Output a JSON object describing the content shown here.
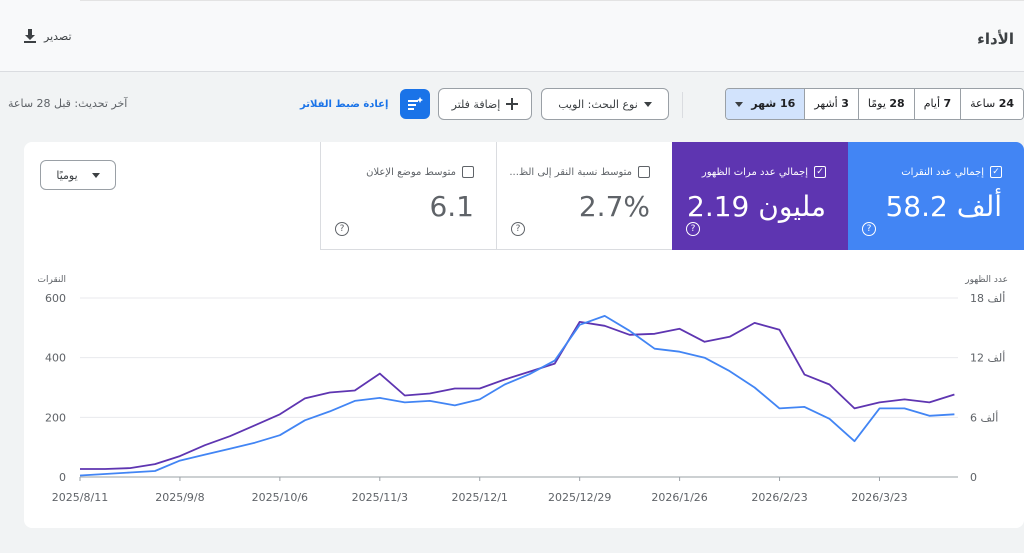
{
  "header": {
    "title": "الأداء",
    "export_label": "تصدير"
  },
  "filters": {
    "last_updated": "آخر تحديث: قبل 28 ساعة",
    "reset_label": "إعادة ضبط الفلاتر",
    "add_filter_label": "إضافة فلتر",
    "search_type_label": "نوع البحث: الويب",
    "date_ranges": [
      {
        "num": "24",
        "unit": "ساعة"
      },
      {
        "num": "7",
        "unit": "أيام"
      },
      {
        "num": "28",
        "unit": "يومًا"
      },
      {
        "num": "3",
        "unit": "أشهر"
      },
      {
        "num": "16",
        "unit": "شهر"
      }
    ],
    "selected_range_index": 4
  },
  "metrics": {
    "clicks": {
      "label": "إجمالي عدد النقرات",
      "value": "58.2 ألف",
      "checked": true,
      "color": "#4285f4"
    },
    "impressions": {
      "label": "إجمالي عدد مرات الظهور",
      "value": "2.19 مليون",
      "checked": true,
      "color": "#5e35b1"
    },
    "ctr": {
      "label": "متوسط نسبة النقر إلى الظ...",
      "value": "2.7%",
      "checked": false
    },
    "position": {
      "label": "متوسط موضع الإعلان",
      "value": "6.1",
      "checked": false
    }
  },
  "granularity": {
    "label": "يوميًا"
  },
  "chart_data": {
    "type": "line",
    "left_axis_title": "النقرات",
    "right_axis_title": "عدد الظهور",
    "left_ticks": [
      "0",
      "200",
      "400",
      "600"
    ],
    "right_ticks": [
      "0",
      "6 ألف",
      "12 ألف",
      "18 ألف"
    ],
    "left_ylim": [
      0,
      600
    ],
    "right_ylim": [
      0,
      18000
    ],
    "x_labels": [
      "2025/8/11",
      "2025/9/8",
      "2025/10/6",
      "2025/11/3",
      "2025/12/1",
      "2025/12/29",
      "2026/1/26",
      "2026/2/23",
      "2026/3/23"
    ],
    "grid": true,
    "series": [
      {
        "name": "إجمالي عدد النقرات",
        "axis": "left",
        "color": "#4285f4",
        "x": [
          "2025/8/11",
          "2025/8/18",
          "2025/8/25",
          "2025/9/1",
          "2025/9/8",
          "2025/9/15",
          "2025/9/22",
          "2025/9/29",
          "2025/10/6",
          "2025/10/13",
          "2025/10/20",
          "2025/10/27",
          "2025/11/3",
          "2025/11/10",
          "2025/11/17",
          "2025/11/24",
          "2025/12/1",
          "2025/12/8",
          "2025/12/15",
          "2025/12/22",
          "2025/12/29",
          "2026/1/5",
          "2026/1/12",
          "2026/1/19",
          "2026/1/26",
          "2026/2/2",
          "2026/2/9",
          "2026/2/16",
          "2026/2/23",
          "2026/3/2",
          "2026/3/9",
          "2026/3/16",
          "2026/3/23",
          "2026/3/30",
          "2026/4/6",
          "2026/4/13"
        ],
        "values": [
          5,
          10,
          15,
          20,
          55,
          75,
          95,
          115,
          140,
          190,
          220,
          255,
          265,
          250,
          255,
          240,
          260,
          310,
          345,
          390,
          510,
          540,
          490,
          430,
          420,
          400,
          355,
          300,
          230,
          235,
          195,
          120,
          230,
          230,
          205,
          210
        ]
      },
      {
        "name": "إجمالي عدد مرات الظهور",
        "axis": "right",
        "color": "#5e35b1",
        "x": [
          "2025/8/11",
          "2025/8/18",
          "2025/8/25",
          "2025/9/1",
          "2025/9/8",
          "2025/9/15",
          "2025/9/22",
          "2025/9/29",
          "2025/10/6",
          "2025/10/13",
          "2025/10/20",
          "2025/10/27",
          "2025/11/3",
          "2025/11/10",
          "2025/11/17",
          "2025/11/24",
          "2025/12/1",
          "2025/12/8",
          "2025/12/15",
          "2025/12/22",
          "2025/12/29",
          "2026/1/5",
          "2026/1/12",
          "2026/1/19",
          "2026/1/26",
          "2026/2/2",
          "2026/2/9",
          "2026/2/16",
          "2026/2/23",
          "2026/3/2",
          "2026/3/9",
          "2026/3/16",
          "2026/3/23",
          "2026/3/30",
          "2026/4/6",
          "2026/4/13"
        ],
        "values": [
          800,
          800,
          900,
          1300,
          2100,
          3200,
          4100,
          5200,
          6300,
          7900,
          8500,
          8700,
          10400,
          8200,
          8400,
          8900,
          8900,
          9800,
          10600,
          11400,
          15600,
          15200,
          14300,
          14400,
          14900,
          13600,
          14100,
          15500,
          14800,
          10300,
          9300,
          6900,
          7500,
          7800,
          7500,
          8300
        ]
      }
    ]
  }
}
